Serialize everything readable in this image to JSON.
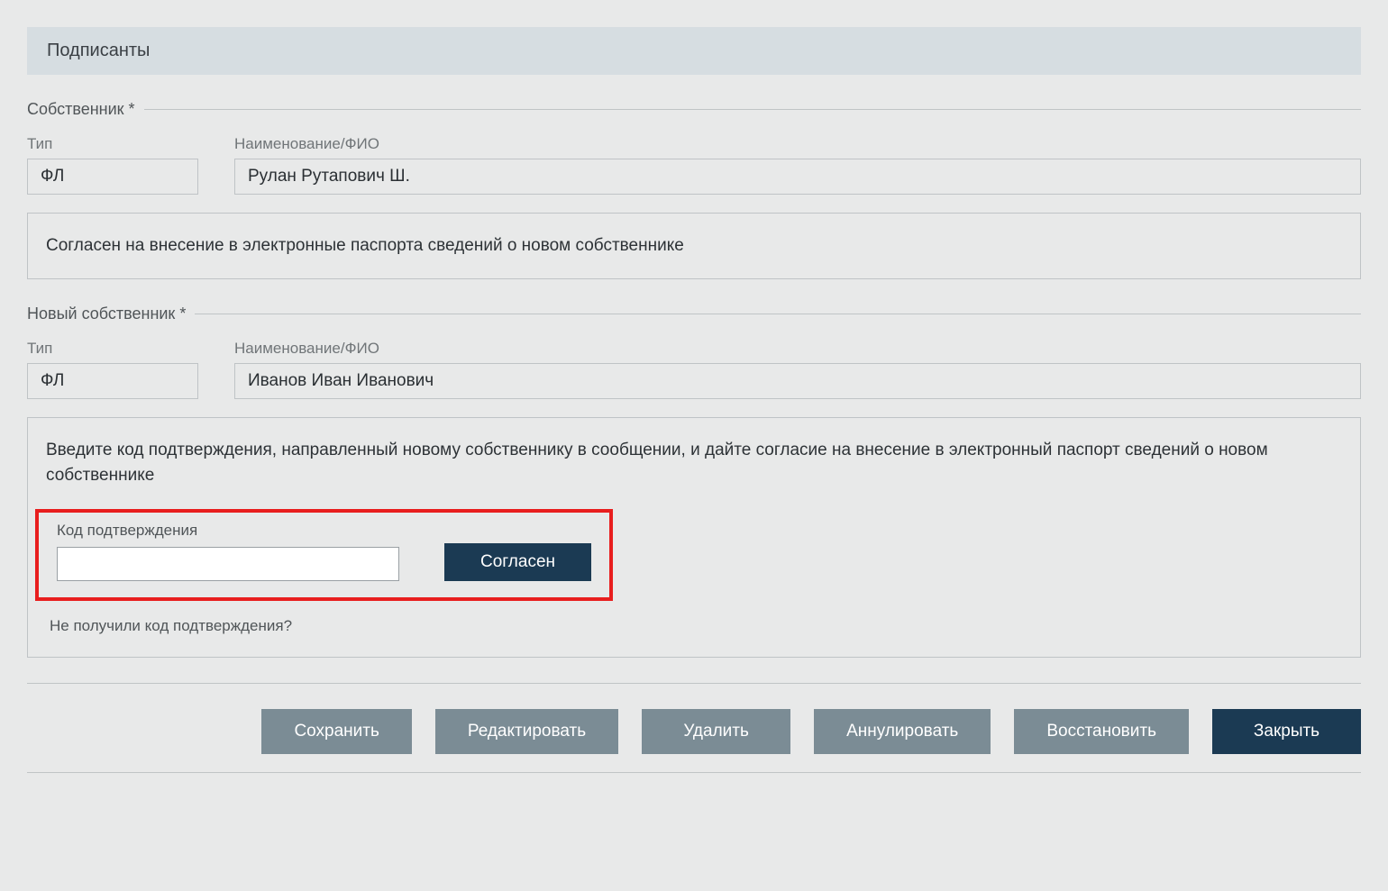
{
  "section_title": "Подписанты",
  "owner": {
    "legend": "Собственник *",
    "type_label": "Тип",
    "type_value": "ФЛ",
    "name_label": "Наименование/ФИО",
    "name_value": "Рулан Рутапович Ш.",
    "consent_text": "Согласен на внесение в электронные паспорта сведений о новом собственнике"
  },
  "new_owner": {
    "legend": "Новый собственник *",
    "type_label": "Тип",
    "type_value": "ФЛ",
    "name_label": "Наименование/ФИО",
    "name_value": "Иванов Иван Иванович",
    "instruction": "Введите код подтверждения, направленный новому собственнику в сообщении, и дайте согласие на внесение в электронный паспорт сведений о новом собственнике",
    "code_label": "Код подтверждения",
    "code_value": "",
    "agree_button": "Согласен",
    "not_received": "Не получили код подтверждения?"
  },
  "actions": {
    "save": "Сохранить",
    "edit": "Редактировать",
    "delete": "Удалить",
    "annul": "Аннулировать",
    "restore": "Восстановить",
    "close": "Закрыть"
  }
}
